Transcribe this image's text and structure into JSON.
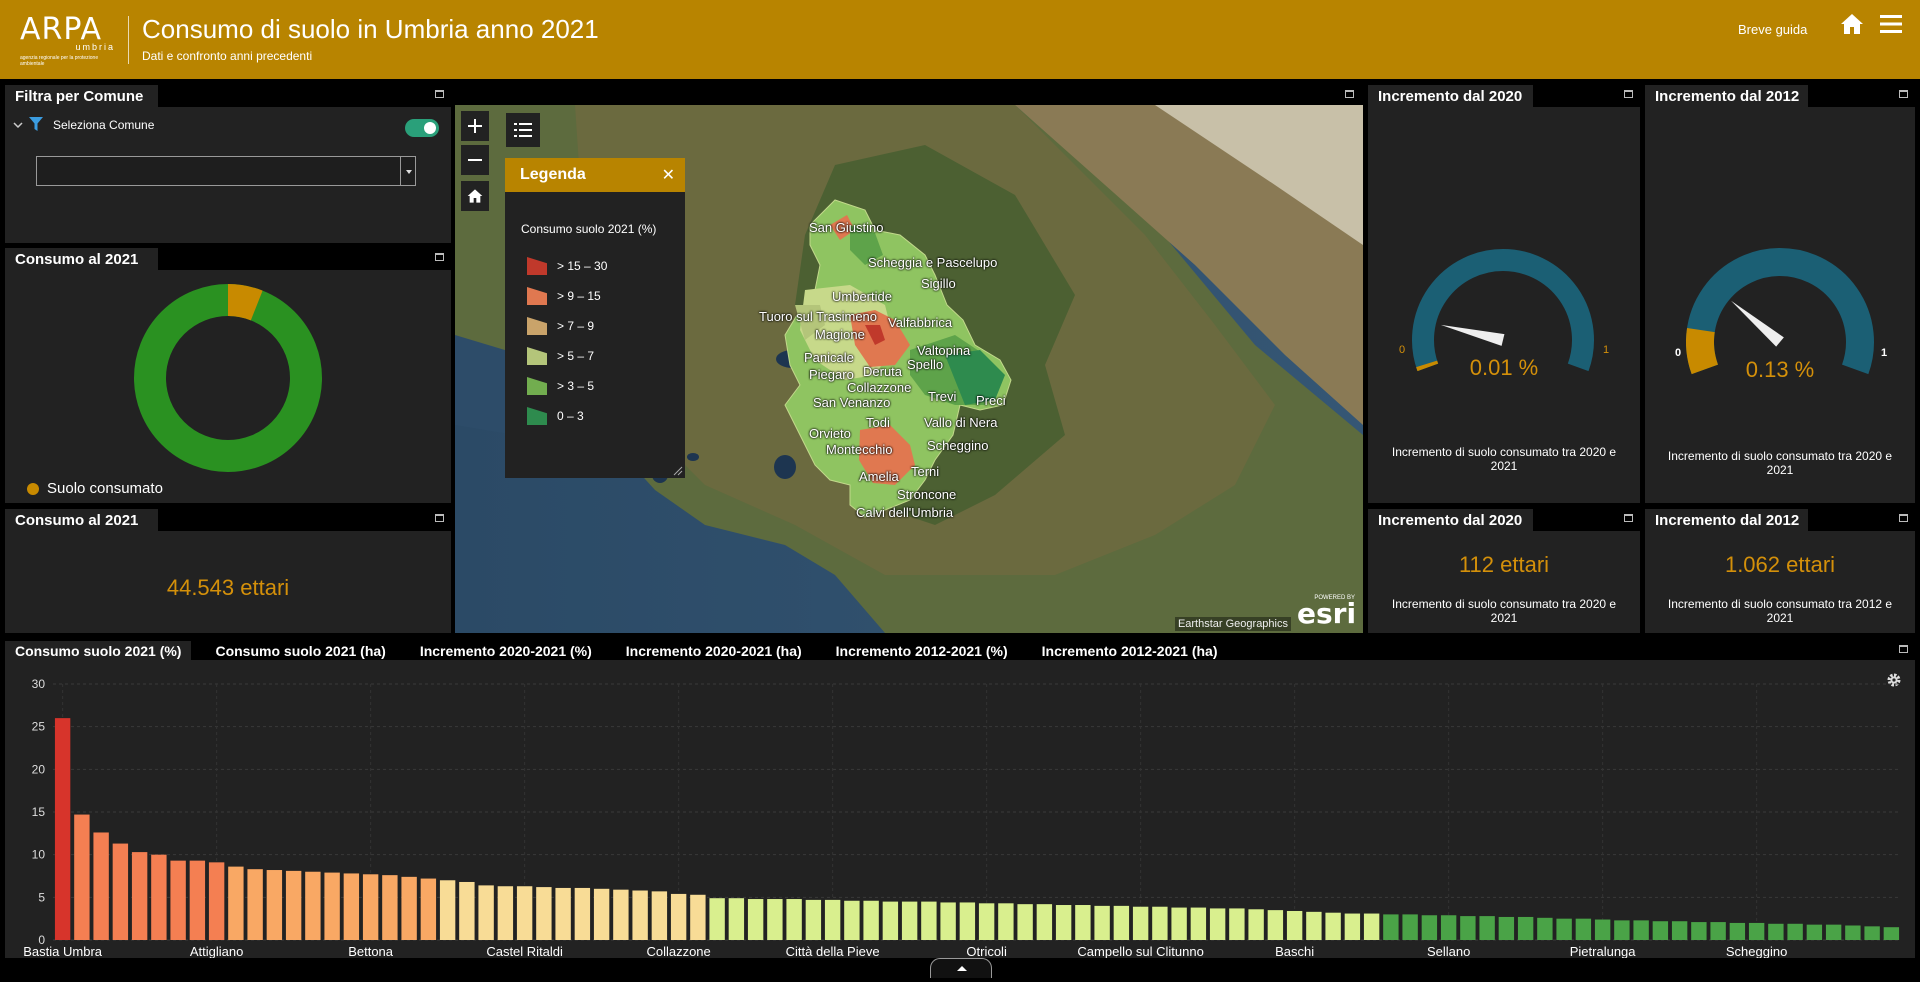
{
  "header": {
    "logo_main": "ARPA",
    "logo_sub": "umbria",
    "logo_tag": "agenzia regionale per la protezione ambientale",
    "title": "Consumo di suolo in Umbria anno 2021",
    "subtitle": "Dati e confronto anni precedenti",
    "guide_label": "Breve guida",
    "home_icon": "home-icon",
    "menu_icon": "hamburger-menu-icon",
    "accent_color": "#b88400"
  },
  "filter_panel": {
    "title": "Filtra per Comune",
    "row_label": "Seleziona Comune",
    "toggle_on": true,
    "select_value": ""
  },
  "donut_panel": {
    "title": "Consumo al 2021",
    "legend_label": "Suolo consumato",
    "consumed_share": 0.06
  },
  "total_panel": {
    "title": "Consumo al 2021",
    "value": "44.543 ettari"
  },
  "gauge_2020": {
    "title": "Incremento dal 2020",
    "min": "0",
    "max": "1",
    "value_text": "0.01 %",
    "value": 0.01,
    "desc": "Incremento di suolo consumato tra 2020 e 2021"
  },
  "gauge_2012": {
    "title": "Incremento dal 2012",
    "min": "0",
    "max": "1",
    "value_text": "0.13 %",
    "value": 0.13,
    "desc": "Incremento di suolo consumato tra 2020 e 2021"
  },
  "ha_2020": {
    "title": "Incremento dal 2020",
    "value": "112 ettari",
    "desc": "Incremento di suolo consumato tra 2020 e 2021"
  },
  "ha_2012": {
    "title": "Incremento dal 2012",
    "value": "1.062 ettari",
    "desc": "Incremento di suolo consumato tra 2012 e 2021"
  },
  "map": {
    "legend_title": "Legenda",
    "legend_subtitle": "Consumo suolo 2021 (%)",
    "legend_items": [
      {
        "label": "> 15 – 30",
        "color": "#c0392b"
      },
      {
        "label": "> 9 – 15",
        "color": "#e07850"
      },
      {
        "label": "> 7 – 9",
        "color": "#c9a36a"
      },
      {
        "label": "> 5 – 7",
        "color": "#b4c57a"
      },
      {
        "label": "> 3 – 5",
        "color": "#72ad4f"
      },
      {
        "label": "0 – 3",
        "color": "#2e8b4e"
      }
    ],
    "labels": {
      "san_giustino": "San Giustino",
      "scheggia": "Scheggia e Pascelupo",
      "sigillo": "Sigillo",
      "umbertide": "Umbertide",
      "tuoro": "Tuoro sul Trasimeno",
      "valfabbrica": "Valfabbrica",
      "magione": "Magione",
      "valtopina": "Valtopina",
      "panicale": "Panicale",
      "spello": "Spello",
      "piegaro": "Piegaro",
      "deruta": "Deruta",
      "collazzone": "Collazzone",
      "trevi": "Trevi",
      "preci": "Preci",
      "san_venanzo": "San Venanzo",
      "todi": "Todi",
      "vallo_di_nera": "Vallo di Nera",
      "orvieto": "Orvieto",
      "scheggino": "Scheggino",
      "montecchio": "Montecchio",
      "amelia": "Amelia",
      "terni": "Terni",
      "stroncone": "Stroncone",
      "calvi": "Calvi dell'Umbria"
    },
    "attribution": "Earthstar Geographics",
    "esri_powered": "POWERED BY",
    "esri_word": "esri"
  },
  "chart_tabs": [
    "Consumo suolo 2021 (%)",
    "Consumo suolo 2021 (ha)",
    "Incremento 2020-2021 (%)",
    "Incremento 2020-2021 (ha)",
    "Incremento 2012-2021 (%)",
    "Incremento 2012-2021 (ha)"
  ],
  "chart_data": {
    "type": "bar",
    "title": "",
    "xlabel": "",
    "ylabel": "",
    "ylim": [
      0,
      30
    ],
    "yticks": [
      0,
      5,
      10,
      15,
      20,
      25,
      30
    ],
    "grid": true,
    "xtick_labels": [
      {
        "index": 0,
        "label": "Bastia Umbra"
      },
      {
        "index": 8,
        "label": "Attigliano"
      },
      {
        "index": 16,
        "label": "Bettona"
      },
      {
        "index": 24,
        "label": "Castel Ritaldi"
      },
      {
        "index": 32,
        "label": "Collazzone"
      },
      {
        "index": 40,
        "label": "Città della Pieve"
      },
      {
        "index": 48,
        "label": "Otricoli"
      },
      {
        "index": 56,
        "label": "Campello sul Clitunno"
      },
      {
        "index": 64,
        "label": "Baschi"
      },
      {
        "index": 72,
        "label": "Sellano"
      },
      {
        "index": 80,
        "label": "Pietralunga"
      },
      {
        "index": 88,
        "label": "Scheggino"
      }
    ],
    "values": [
      26.0,
      14.7,
      12.6,
      11.3,
      10.3,
      10.0,
      9.3,
      9.3,
      9.1,
      8.6,
      8.3,
      8.2,
      8.1,
      8.0,
      7.9,
      7.8,
      7.7,
      7.6,
      7.4,
      7.2,
      7.0,
      6.8,
      6.4,
      6.3,
      6.3,
      6.2,
      6.1,
      6.1,
      6.0,
      5.9,
      5.8,
      5.7,
      5.4,
      5.3,
      4.9,
      4.9,
      4.8,
      4.8,
      4.8,
      4.7,
      4.7,
      4.6,
      4.6,
      4.5,
      4.5,
      4.5,
      4.4,
      4.4,
      4.3,
      4.3,
      4.2,
      4.2,
      4.1,
      4.1,
      4.0,
      4.0,
      3.9,
      3.9,
      3.8,
      3.8,
      3.7,
      3.7,
      3.6,
      3.5,
      3.4,
      3.3,
      3.2,
      3.1,
      3.1,
      3.0,
      3.0,
      2.9,
      2.9,
      2.8,
      2.8,
      2.7,
      2.7,
      2.6,
      2.5,
      2.5,
      2.4,
      2.3,
      2.3,
      2.2,
      2.2,
      2.1,
      2.1,
      2.0,
      2.0,
      1.9,
      1.9,
      1.8,
      1.8,
      1.7,
      1.6,
      1.5
    ],
    "class_colors": {
      "c15_30": "#d7342b",
      "c9_15": "#f47f52",
      "c7_9": "#f9a864",
      "c5_7": "#f8dc96",
      "c3_5": "#d9ef8e",
      "c0_3": "#4aa347"
    }
  }
}
